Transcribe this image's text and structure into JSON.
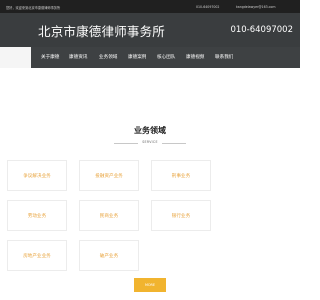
{
  "topbar": {
    "welcome": "您好，欢迎来到北京市康德律师事务所",
    "phone": "010-64097002",
    "email": "kangdelawyer@163.com"
  },
  "header": {
    "logo": "北京市康德律师事务所",
    "hotline": "010-64097002"
  },
  "nav": {
    "items": [
      "关于康德",
      "康德资讯",
      "业务领域",
      "康德案例",
      "核心团队",
      "康德视频",
      "联系我们"
    ]
  },
  "section": {
    "title": "业务领域",
    "subtitle": "SERVICE"
  },
  "cards": [
    "争议解决业务",
    "投融资产业务",
    "刑事业务",
    "劳动业务",
    "民商业务",
    "银行业务",
    "房地产业业务",
    "破产业务"
  ],
  "more_button": "MORE",
  "colors": {
    "accent": "#f1b42f",
    "card_text": "#e8a33c",
    "header_bg": "#3a3d3f",
    "topbar_bg": "#202020"
  }
}
